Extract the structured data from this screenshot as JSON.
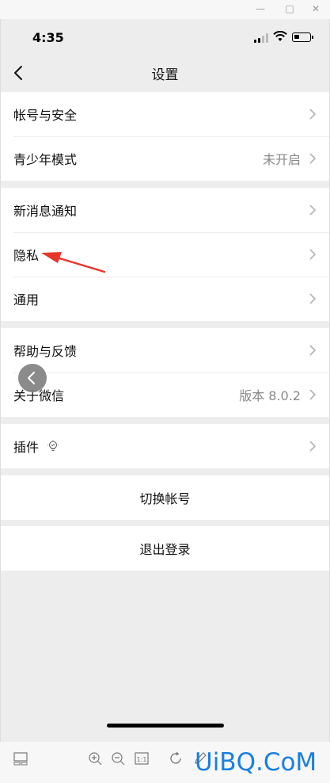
{
  "status_bar": {
    "time": "4:35"
  },
  "nav": {
    "title": "设置"
  },
  "groups": [
    {
      "items": [
        {
          "label": "帐号与安全",
          "value": ""
        },
        {
          "label": "青少年模式",
          "value": "未开启"
        }
      ]
    },
    {
      "items": [
        {
          "label": "新消息通知",
          "value": ""
        },
        {
          "label": "隐私",
          "value": ""
        },
        {
          "label": "通用",
          "value": ""
        }
      ]
    },
    {
      "items": [
        {
          "label": "帮助与反馈",
          "value": ""
        },
        {
          "label": "关于微信",
          "value": "版本 8.0.2"
        }
      ]
    },
    {
      "items": [
        {
          "label": "插件",
          "value": "",
          "icon": "lightbulb-icon"
        }
      ]
    }
  ],
  "actions": {
    "switch_account": "切换帐号",
    "logout": "退出登录"
  },
  "watermark": "UiBQ.CoM",
  "colors": {
    "annotation_arrow": "#e8352b",
    "watermark": "#1a7fe0",
    "background": "#ededed"
  }
}
